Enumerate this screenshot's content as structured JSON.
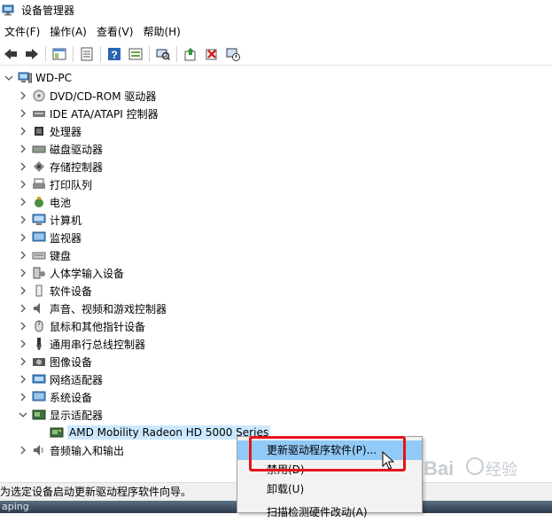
{
  "window": {
    "title": "设备管理器"
  },
  "menu": [
    "文件(F)",
    "操作(A)",
    "查看(V)",
    "帮助(H)"
  ],
  "toolbar_icons": [
    "back-arrow-icon",
    "forward-arrow-icon",
    "show-hide-tree-icon",
    "properties-icon",
    "help-icon",
    "view-resources-icon",
    "scan-hardware-icon",
    "update-driver-icon",
    "uninstall-icon",
    "disable-icon"
  ],
  "tree": {
    "root": "WD-PC",
    "categories": [
      {
        "label": "DVD/CD-ROM 驱动器",
        "icon": "dvd-drive-icon"
      },
      {
        "label": "IDE ATA/ATAPI 控制器",
        "icon": "ide-controller-icon"
      },
      {
        "label": "处理器",
        "icon": "processor-icon"
      },
      {
        "label": "磁盘驱动器",
        "icon": "disk-drive-icon"
      },
      {
        "label": "存储控制器",
        "icon": "storage-controller-icon"
      },
      {
        "label": "打印队列",
        "icon": "printer-icon"
      },
      {
        "label": "电池",
        "icon": "battery-icon"
      },
      {
        "label": "计算机",
        "icon": "computer-icon"
      },
      {
        "label": "监视器",
        "icon": "monitor-icon"
      },
      {
        "label": "键盘",
        "icon": "keyboard-icon"
      },
      {
        "label": "人体学输入设备",
        "icon": "hid-icon"
      },
      {
        "label": "软件设备",
        "icon": "software-device-icon"
      },
      {
        "label": "声音、视频和游戏控制器",
        "icon": "sound-icon"
      },
      {
        "label": "鼠标和其他指针设备",
        "icon": "mouse-icon"
      },
      {
        "label": "通用串行总线控制器",
        "icon": "usb-icon"
      },
      {
        "label": "图像设备",
        "icon": "camera-icon"
      },
      {
        "label": "网络适配器",
        "icon": "network-adapter-icon"
      },
      {
        "label": "系统设备",
        "icon": "system-device-icon"
      },
      {
        "label": "显示适配器",
        "icon": "display-adapter-icon"
      }
    ],
    "child": "AMD Mobility Radeon HD 5000 Series",
    "after": {
      "label": "音频输入和输出",
      "icon": "audio-io-icon"
    }
  },
  "context_menu": {
    "items": [
      "更新驱动程序软件(P)...",
      "禁用(D)",
      "卸载(U)",
      "扫描检测硬件改动(A)"
    ]
  },
  "status": "为选定设备启动更新驱动程序软件向导。",
  "taskbar_text": "aping",
  "watermark": "Baidu 经验"
}
